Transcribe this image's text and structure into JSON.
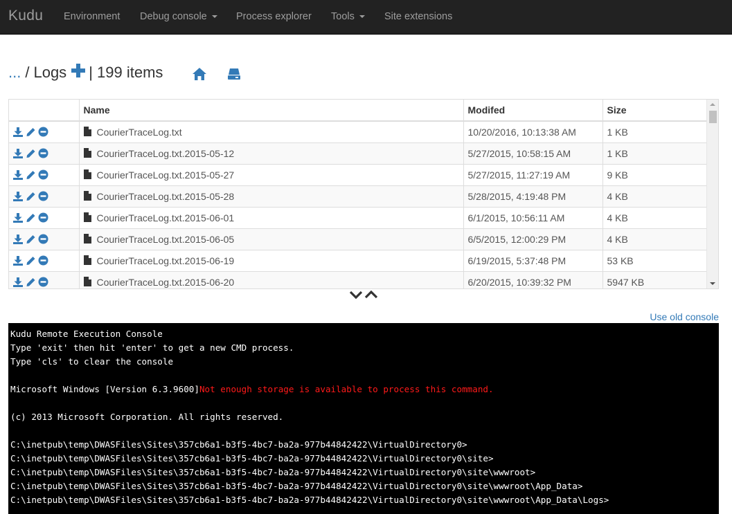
{
  "navbar": {
    "brand": "Kudu",
    "items": [
      {
        "label": "Environment",
        "dropdown": false
      },
      {
        "label": "Debug console",
        "dropdown": true
      },
      {
        "label": "Process explorer",
        "dropdown": false
      },
      {
        "label": "Tools",
        "dropdown": true
      },
      {
        "label": "Site extensions",
        "dropdown": false
      }
    ]
  },
  "breadcrumb": {
    "ellipsis": "...",
    "separator": "/",
    "folder": "Logs",
    "count": "| 199 items"
  },
  "icons": [
    "plus-icon",
    "home-icon",
    "drive-icon",
    "download-icon",
    "pencil-icon",
    "remove-icon",
    "file-icon",
    "chevron-down-icon",
    "chevron-up-icon"
  ],
  "colors": {
    "accent": "#337ab7",
    "navbar": "#222222",
    "error_text": "#ff1a1a"
  },
  "table": {
    "headers": [
      "",
      "Name",
      "Modifed",
      "Size"
    ],
    "rows": [
      {
        "name": "CourierTraceLog.txt",
        "modified": "10/20/2016, 10:13:38 AM",
        "size": "1 KB"
      },
      {
        "name": "CourierTraceLog.txt.2015-05-12",
        "modified": "5/27/2015, 10:58:15 AM",
        "size": "1 KB"
      },
      {
        "name": "CourierTraceLog.txt.2015-05-27",
        "modified": "5/27/2015, 11:27:19 AM",
        "size": "9 KB"
      },
      {
        "name": "CourierTraceLog.txt.2015-05-28",
        "modified": "5/28/2015, 4:19:48 PM",
        "size": "4 KB"
      },
      {
        "name": "CourierTraceLog.txt.2015-06-01",
        "modified": "6/1/2015, 10:56:11 AM",
        "size": "4 KB"
      },
      {
        "name": "CourierTraceLog.txt.2015-06-05",
        "modified": "6/5/2015, 12:00:29 PM",
        "size": "4 KB"
      },
      {
        "name": "CourierTraceLog.txt.2015-06-19",
        "modified": "6/19/2015, 5:37:48 PM",
        "size": "53 KB"
      },
      {
        "name": "CourierTraceLog.txt.2015-06-20",
        "modified": "6/20/2015, 10:39:32 PM",
        "size": "5947 KB"
      }
    ]
  },
  "links": {
    "old_console": "Use old console"
  },
  "console": {
    "lines": [
      {
        "text": "Kudu Remote Execution Console"
      },
      {
        "text": "Type 'exit' then hit 'enter' to get a new CMD process."
      },
      {
        "text": "Type 'cls' to clear the console"
      },
      {
        "text": ""
      },
      {
        "text": "Microsoft Windows [Version 6.3.9600]",
        "error": "Not enough storage is available to process this command."
      },
      {
        "text": ""
      },
      {
        "text": "(c) 2013 Microsoft Corporation. All rights reserved."
      },
      {
        "text": ""
      },
      {
        "text": "C:\\inetpub\\temp\\DWASFiles\\Sites\\357cb6a1-b3f5-4bc7-ba2a-977b44842422\\VirtualDirectory0>"
      },
      {
        "text": "C:\\inetpub\\temp\\DWASFiles\\Sites\\357cb6a1-b3f5-4bc7-ba2a-977b44842422\\VirtualDirectory0\\site>"
      },
      {
        "text": "C:\\inetpub\\temp\\DWASFiles\\Sites\\357cb6a1-b3f5-4bc7-ba2a-977b44842422\\VirtualDirectory0\\site\\wwwroot>"
      },
      {
        "text": "C:\\inetpub\\temp\\DWASFiles\\Sites\\357cb6a1-b3f5-4bc7-ba2a-977b44842422\\VirtualDirectory0\\site\\wwwroot\\App_Data>"
      },
      {
        "text": "C:\\inetpub\\temp\\DWASFiles\\Sites\\357cb6a1-b3f5-4bc7-ba2a-977b44842422\\VirtualDirectory0\\site\\wwwroot\\App_Data\\Logs>"
      }
    ]
  }
}
